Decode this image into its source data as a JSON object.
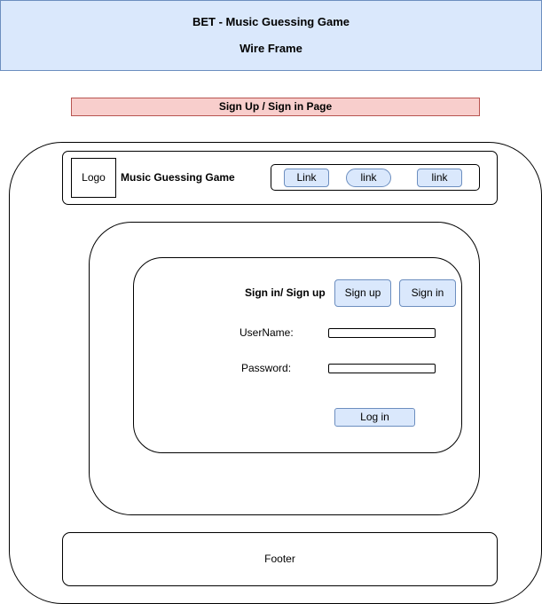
{
  "banner": {
    "title": "BET - Music Guessing Game",
    "subtitle": "Wire Frame"
  },
  "page_label": "Sign Up / Sign in Page",
  "navbar": {
    "logo": "Logo",
    "site_title": "Music Guessing Game",
    "links": [
      "Link",
      "link",
      "link"
    ]
  },
  "auth": {
    "heading": "Sign in/ Sign up",
    "tabs": [
      "Sign up",
      "Sign in"
    ],
    "username_label": "UserName:",
    "password_label": "Password:",
    "login_button": "Log in"
  },
  "footer": {
    "label": "Footer"
  },
  "colors": {
    "banner_fill": "#dae8fc",
    "banner_stroke": "#6c8ebf",
    "page_label_fill": "#f8cecc",
    "page_label_stroke": "#b85450",
    "button_fill": "#dae8fc",
    "button_stroke": "#6c8ebf"
  }
}
